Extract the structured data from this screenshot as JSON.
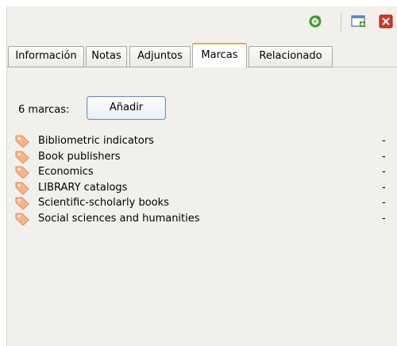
{
  "toolbar": {
    "sync_icon": "sync-icon",
    "new_window_icon": "new-window-icon",
    "close_icon": "close-icon"
  },
  "tabs": [
    {
      "label": "Información"
    },
    {
      "label": "Notas"
    },
    {
      "label": "Adjuntos"
    },
    {
      "label": "Marcas",
      "active": true
    },
    {
      "label": "Relacionado"
    }
  ],
  "tags_panel": {
    "count_label": "6 marcas:",
    "add_button": "Añadir",
    "remove_symbol": "-",
    "items": [
      {
        "label": "Bibliometric indicators"
      },
      {
        "label": "Book publishers"
      },
      {
        "label": "Economics"
      },
      {
        "label": "LIBRARY catalogs"
      },
      {
        "label": "Scientific-scholarly books"
      },
      {
        "label": "Social sciences and humanities"
      }
    ]
  },
  "colors": {
    "panel_bg": "#f1f0ec",
    "active_tab_accent": "#f2a93b",
    "tag_icon": "#f5b68c",
    "close_red": "#d9342b",
    "sync_green": "#3e9b2f"
  }
}
